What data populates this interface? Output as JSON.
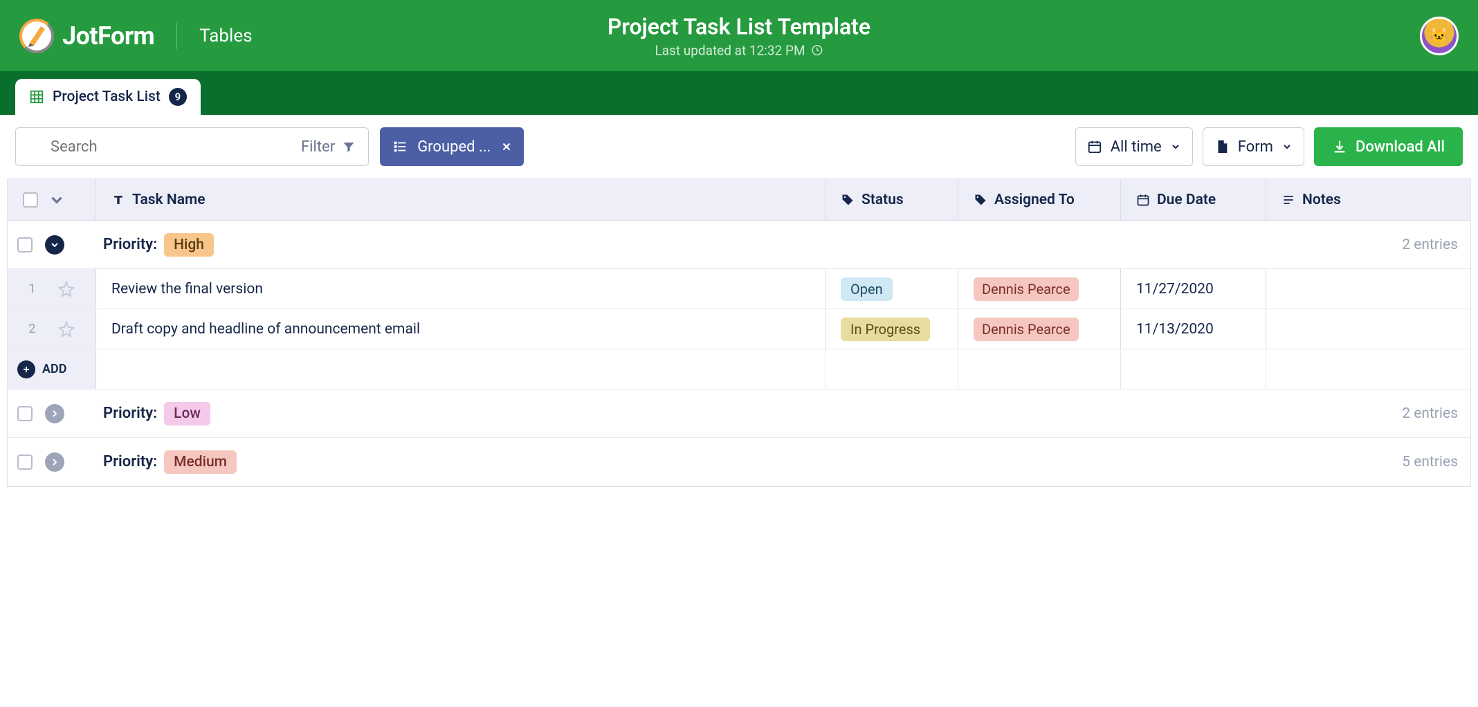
{
  "header": {
    "brand": "JotForm",
    "product": "Tables",
    "title": "Project Task List Template",
    "updated": "Last updated at 12:32 PM"
  },
  "tab": {
    "label": "Project Task List",
    "count": "9"
  },
  "toolbar": {
    "search_placeholder": "Search",
    "filter_label": "Filter",
    "grouped_label": "Grouped ...",
    "alltime_label": "All time",
    "form_label": "Form",
    "download_label": "Download All"
  },
  "columns": {
    "task": "Task Name",
    "status": "Status",
    "assigned": "Assigned To",
    "due": "Due Date",
    "notes": "Notes"
  },
  "groups": [
    {
      "label": "Priority:",
      "badge": "High",
      "badge_class": "badge-high",
      "expanded": true,
      "entries_text": "2 entries",
      "rows": [
        {
          "num": "1",
          "task": "Review the final version",
          "status": "Open",
          "status_class": "pill-open",
          "assigned": "Dennis Pearce",
          "due": "11/27/2020",
          "notes": ""
        },
        {
          "num": "2",
          "task": "Draft copy and headline of announcement email",
          "status": "In Progress",
          "status_class": "pill-progress",
          "assigned": "Dennis Pearce",
          "due": "11/13/2020",
          "notes": ""
        }
      ]
    },
    {
      "label": "Priority:",
      "badge": "Low",
      "badge_class": "badge-low",
      "expanded": false,
      "entries_text": "2 entries",
      "rows": []
    },
    {
      "label": "Priority:",
      "badge": "Medium",
      "badge_class": "badge-medium",
      "expanded": false,
      "entries_text": "5 entries",
      "rows": []
    }
  ],
  "add_label": "ADD"
}
